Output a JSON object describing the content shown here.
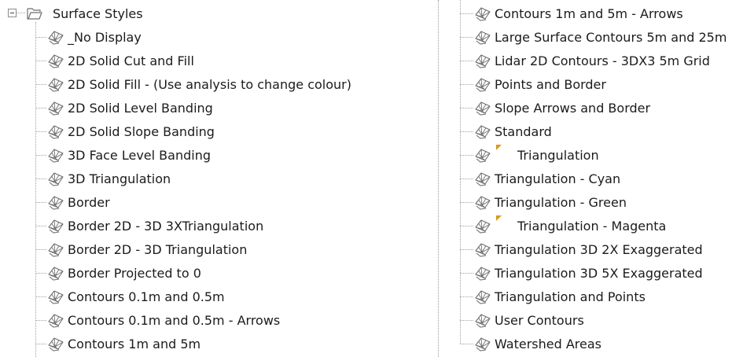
{
  "tree": {
    "root_label": "Surface Styles",
    "left_items": [
      {
        "label": "_No Display"
      },
      {
        "label": "2D Solid Cut and Fill"
      },
      {
        "label": "2D Solid Fill - (Use analysis to change colour)"
      },
      {
        "label": "2D Solid Level Banding"
      },
      {
        "label": "2D Solid Slope Banding"
      },
      {
        "label": "3D Face Level Banding"
      },
      {
        "label": "3D Triangulation"
      },
      {
        "label": "Border"
      },
      {
        "label": "Border 2D - 3D 3XTriangulation"
      },
      {
        "label": "Border 2D - 3D Triangulation"
      },
      {
        "label": "Border Projected to 0"
      },
      {
        "label": "Contours 0.1m and 0.5m"
      },
      {
        "label": "Contours 0.1m and 0.5m - Arrows"
      },
      {
        "label": "Contours 1m and 5m"
      }
    ],
    "right_items": [
      {
        "label": "Contours 1m and 5m - Arrows"
      },
      {
        "label": "Large Surface Contours 5m and 25m"
      },
      {
        "label": "Lidar 2D Contours - 3DX3 5m Grid"
      },
      {
        "label": "Points and Border"
      },
      {
        "label": "Slope Arrows and Border"
      },
      {
        "label": "Standard"
      },
      {
        "label": "Triangulation",
        "flag": true
      },
      {
        "label": "Triangulation - Cyan"
      },
      {
        "label": "Triangulation - Green"
      },
      {
        "label": "Triangulation - Magenta",
        "flag": true
      },
      {
        "label": "Triangulation 3D 2X Exaggerated"
      },
      {
        "label": "Triangulation 3D 5X Exaggerated"
      },
      {
        "label": "Triangulation and Points"
      },
      {
        "label": "User Contours"
      },
      {
        "label": "Watershed Areas"
      }
    ]
  },
  "colors": {
    "flag": "#d99a1c",
    "icon_stroke": "#6f6f6f"
  }
}
